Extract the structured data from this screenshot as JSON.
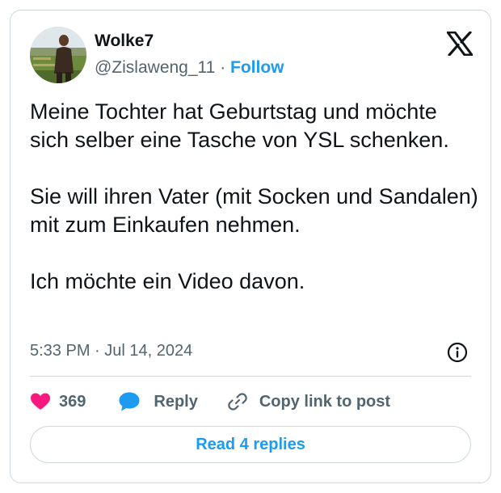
{
  "author": {
    "display_name": "Wolke7",
    "handle": "@Zislaweng_11",
    "separator": "·",
    "follow_label": "Follow",
    "avatar_icon": "profile-photo"
  },
  "brand": {
    "logo_icon": "x-logo-icon"
  },
  "tweet": {
    "paragraphs": [
      "Meine Tochter hat Geburtstag und möchte sich selber eine Tasche von YSL schenken.",
      "Sie will ihren Vater (mit Socken und Sandalen) mit zum Einkaufen nehmen.",
      "Ich möchte ein Video davon."
    ],
    "timestamp": "5:33 PM · Jul 14, 2024"
  },
  "actions": {
    "like_count": "369",
    "reply_label": "Reply",
    "copy_link_label": "Copy link to post",
    "read_replies_label": "Read 4 replies"
  },
  "colors": {
    "accent": "#1d9bf0",
    "like": "#f91880",
    "text": "#0f1419",
    "secondary_text": "#536471",
    "border": "#cfd9de"
  }
}
